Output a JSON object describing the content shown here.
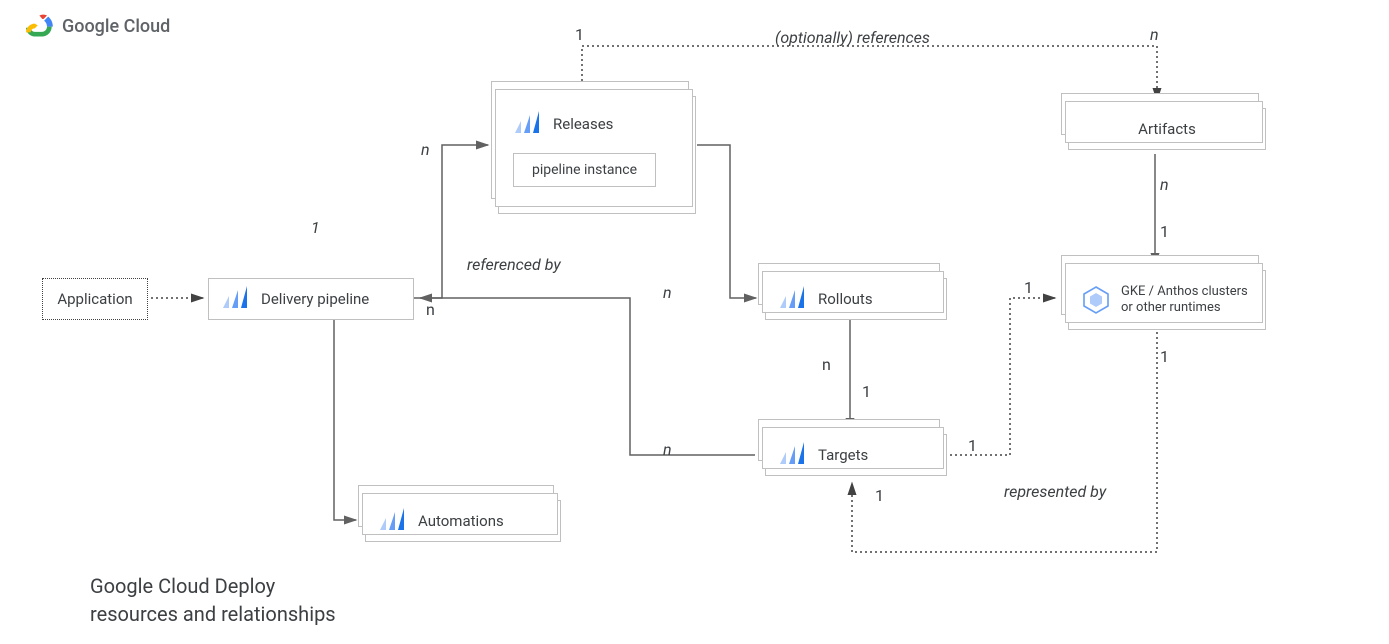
{
  "header": {
    "brand": "Google Cloud"
  },
  "caption": "Google Cloud Deploy\nresources and relationships",
  "nodes": {
    "application": "Application",
    "delivery_pipeline": "Delivery pipeline",
    "releases": "Releases",
    "pipeline_instance": "pipeline instance",
    "rollouts": "Rollouts",
    "targets": "Targets",
    "automations": "Automations",
    "artifacts": "Artifacts",
    "gke": "GKE / Anthos clusters or other runtimes"
  },
  "labels": {
    "optionally_references": "(optionally) references",
    "referenced_by": "referenced by",
    "represented_by": "represented by"
  },
  "cardinality": {
    "one": "1",
    "n": "n"
  }
}
